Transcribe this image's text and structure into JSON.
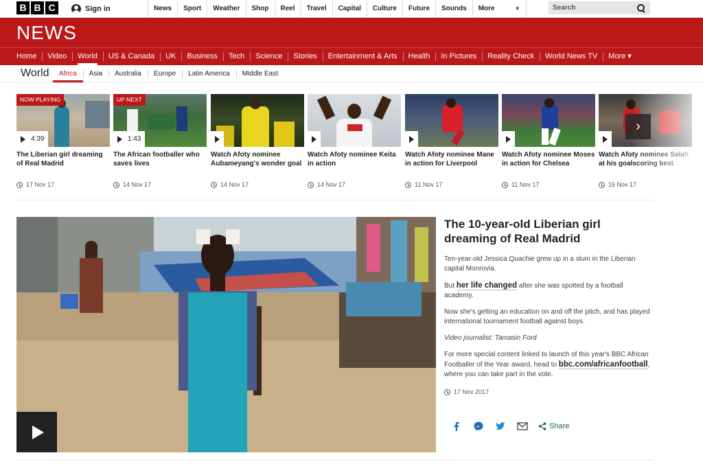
{
  "topbar": {
    "logo_letters": [
      "B",
      "B",
      "C"
    ],
    "signin_label": "Sign in",
    "links": [
      "News",
      "Sport",
      "Weather",
      "Shop",
      "Reel",
      "Travel",
      "Capital",
      "Culture",
      "Future",
      "Sounds"
    ],
    "more_label": "More",
    "search_placeholder": "Search"
  },
  "banner": {
    "title": "NEWS",
    "color": "#bb1919"
  },
  "nav": {
    "items": [
      "Home",
      "Video",
      "World",
      "US & Canada",
      "UK",
      "Business",
      "Tech",
      "Science",
      "Stories",
      "Entertainment & Arts",
      "Health",
      "In Pictures",
      "Reality Check",
      "World News TV",
      "More ▾"
    ],
    "active": "World"
  },
  "subnav": {
    "section": "World",
    "items": [
      "Africa",
      "Asia",
      "Australia",
      "Europe",
      "Latin America",
      "Middle East"
    ],
    "active": "Africa"
  },
  "carousel": [
    {
      "badge": "NOW PLAYING",
      "duration": "4:39",
      "title": "The Liberian girl dreaming of Real Madrid",
      "date": "17 Nov 17"
    },
    {
      "badge": "UP NEXT",
      "duration": "1:43",
      "title": "The African footballer who saves lives",
      "date": "14 Nov 17"
    },
    {
      "badge": "",
      "duration": "",
      "title": "Watch Afoty nominee Aubameyang's wonder goal",
      "date": "14 Nov 17"
    },
    {
      "badge": "",
      "duration": "",
      "title": "Watch Afoty nominee Keita in action",
      "date": "14 Nov 17"
    },
    {
      "badge": "",
      "duration": "",
      "title": "Watch Afoty nominee Mane in action for Liverpool",
      "date": "11 Nov 17"
    },
    {
      "badge": "",
      "duration": "",
      "title": "Watch Afoty nominee Moses in action for Chelsea",
      "date": "11 Nov 17"
    },
    {
      "badge": "",
      "duration": "",
      "title": "Watch Afoty nominee Salah at his goalscoring best",
      "date": "16 Nov 17"
    }
  ],
  "story": {
    "headline": "The 10-year-old Liberian girl dreaming of Real Madrid",
    "p1": "Ten-year-old Jessica Quachie grew up in a slum in the Liberian capital Monrovia.",
    "p2_before": "But ",
    "p2_link": "her life changed",
    "p2_after": " after she was spotted by a football academy.",
    "p3": "Now she's getting an education on and off the pitch, and has played international tournament football against boys.",
    "credit": "Video journalist: Tamasin Ford",
    "p5_before": "For more special content linked to launch of this year's BBC African Footballer of the Year award, head to ",
    "p5_link": "bbc.com/africanfootball",
    "p5_after": ", where you can take part in the vote.",
    "date": "17 Nov 2017",
    "share_label": "Share"
  }
}
